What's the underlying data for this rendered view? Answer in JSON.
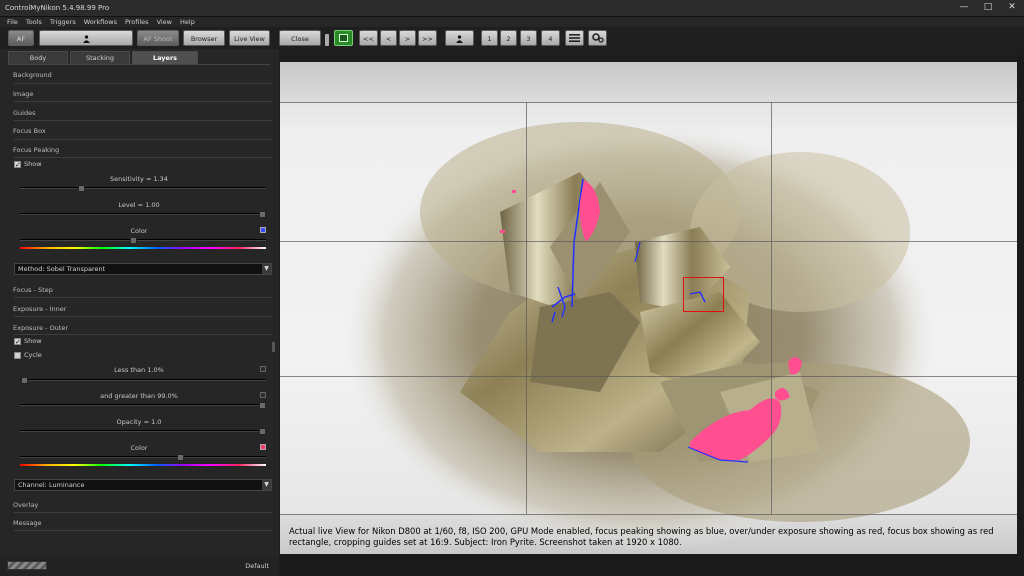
{
  "window": {
    "title": "ControlMyNikon 5.4.98.99 Pro",
    "controls": [
      "—",
      "□",
      "✕"
    ]
  },
  "menu": [
    "File",
    "Tools",
    "Triggers",
    "Workflows",
    "Profiles",
    "View",
    "Help"
  ],
  "toolbar": {
    "af": "AF",
    "af_shoot": "AF Shoot",
    "browser": "Browser",
    "live_view": "Live View",
    "close": "Close",
    "nav": [
      "<<",
      "<",
      ">",
      ">>"
    ],
    "pages": [
      "1",
      "2",
      "3",
      "4"
    ],
    "icons": [
      "person-icon",
      "monitor-icon",
      "menu-icon",
      "settings-icon"
    ]
  },
  "tabs": [
    "Body",
    "Stacking",
    "Layers"
  ],
  "active_tab": "Layers",
  "sections": {
    "background": "Background",
    "image": "Image",
    "guides": "Guides",
    "focus_box": "Focus Box",
    "focus_peaking": "Focus Peaking",
    "focus_step": "Focus - Step",
    "exposure_inner": "Exposure - Inner",
    "exposure_outer": "Exposure - Outer",
    "overlay": "Overlay",
    "message": "Message"
  },
  "focus_peaking": {
    "show_label": "Show",
    "show_checked": true,
    "sensitivity_label": "Sensitivity = 1.34",
    "sensitivity_value": 1.34,
    "level_label": "Level = 1.00",
    "level_value": 1.0,
    "color_label": "Color",
    "color": "#3a4cff",
    "method": "Method: Sobel Transparent"
  },
  "exposure_outer": {
    "show_label": "Show",
    "show_checked": true,
    "cycle_label": "Cycle",
    "cycle_checked": false,
    "less_than_label": "Less than 1.0%",
    "greater_than_label": "and greater than 99.0%",
    "opacity_label": "Opacity = 1.0",
    "color_label": "Color",
    "color": "#ff3a6e",
    "channel": "Channel: Luminance"
  },
  "bottom": {
    "profile": "Default"
  },
  "caption": "Actual live View for Nikon D800 at 1/60, f8, ISO 200, GPU Mode enabled, focus peaking showing as blue, over/under exposure showing as red, focus box showing as red rectangle, cropping guides set at 16:9. Subject: Iron Pyrite. Screenshot taken at 1920 x 1080.",
  "colors": {
    "accent_green": "#2a8a2a",
    "focus_box": "#e01010",
    "peaking": "#2030ff",
    "overexposure": "#ff4f90"
  }
}
